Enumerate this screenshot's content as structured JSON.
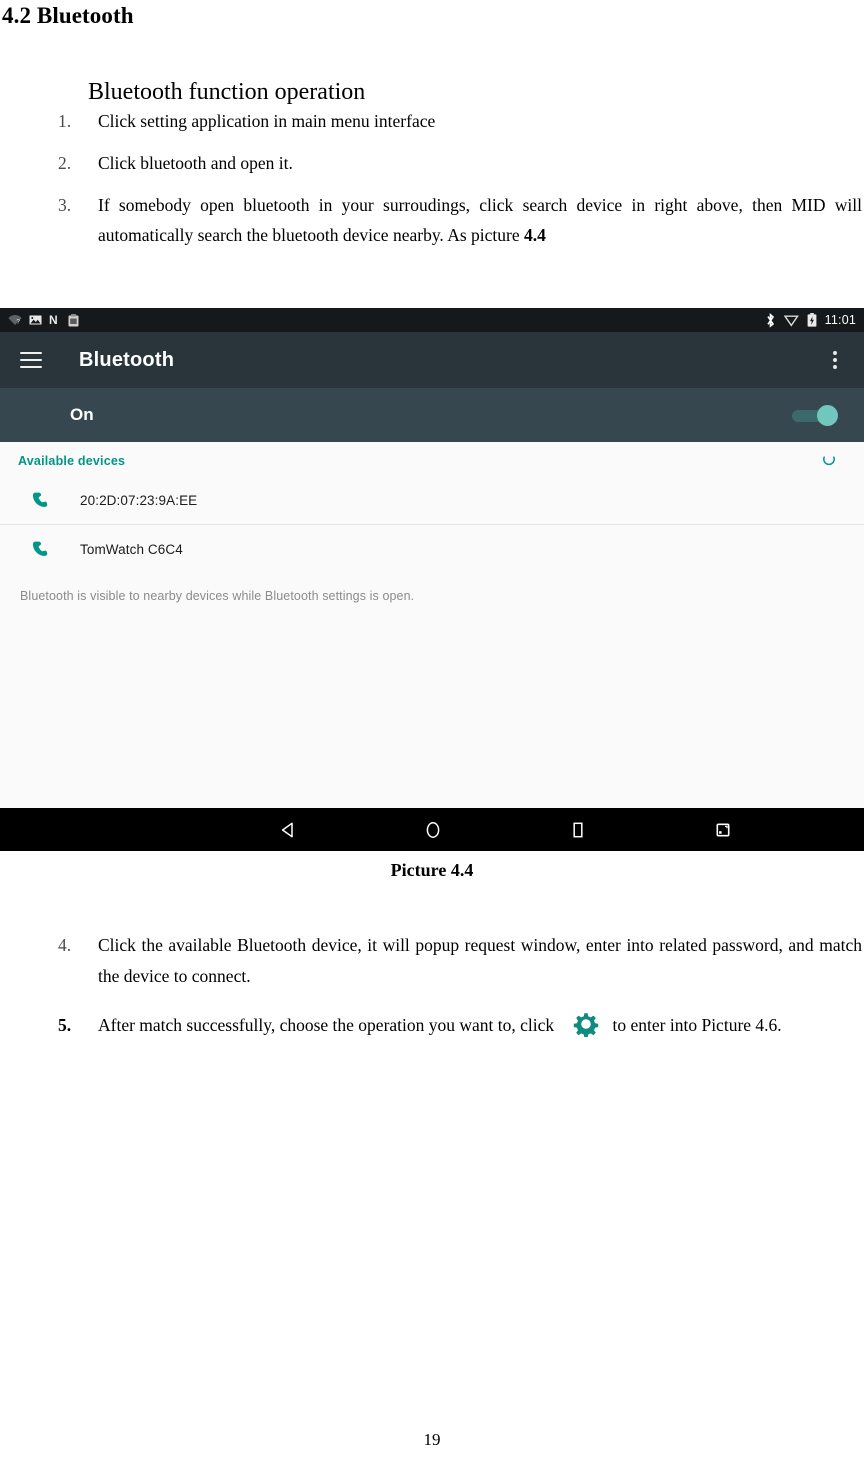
{
  "document": {
    "heading": "4.2 Bluetooth",
    "subheading": "Bluetooth function operation",
    "steps_top": [
      {
        "num": "1.",
        "text": "Click setting application in main menu interface",
        "bold_num": false
      },
      {
        "num": "2.",
        "text": "Click bluetooth and open it.",
        "bold_num": false
      },
      {
        "num": "3.",
        "text": "If somebody open bluetooth in your surroudings, click search device in right above, then MID will automatically search the bluetooth device nearby. As picture ",
        "bold_tail": "4.4",
        "bold_num": false
      }
    ],
    "caption": "Picture 4.4",
    "steps_bottom": [
      {
        "num": "4.",
        "text": "Click the available Bluetooth device, it will popup request window, enter into related password, and match the device to connect.",
        "bold_num": false
      },
      {
        "num": "5.",
        "text_before": "After match successfully, choose the operation you want to, click ",
        "text_after": "to enter into Picture 4.6.",
        "bold_num": true
      }
    ],
    "page_number": "19"
  },
  "screenshot": {
    "statusbar": {
      "left_icons": [
        "wifi-question-icon",
        "photo-icon",
        "android-n-icon",
        "clipboard-icon"
      ],
      "right_icons": [
        "bluetooth-icon",
        "signal-triangle-icon",
        "battery-charging-icon"
      ],
      "time": "11:01"
    },
    "toolbar": {
      "menu_icon": "hamburger-icon",
      "title": "Bluetooth",
      "overflow_icon": "overflow-menu-icon"
    },
    "switch_bar": {
      "label": "On",
      "switch_state": "on"
    },
    "section": {
      "title": "Available devices",
      "refresh_icon": "refresh-icon"
    },
    "devices": [
      {
        "icon": "phone-icon",
        "name": "20:2D:07:23:9A:EE"
      },
      {
        "icon": "phone-icon",
        "name": "TomWatch C6C4"
      }
    ],
    "hint": "Bluetooth is visible to nearby devices while Bluetooth settings is open.",
    "navbar": [
      {
        "name": "back-button",
        "icon": "back-triangle-icon"
      },
      {
        "name": "home-button",
        "icon": "home-circle-icon"
      },
      {
        "name": "recents-button",
        "icon": "recents-square-icon"
      },
      {
        "name": "screenshot-button",
        "icon": "screenshot-icon"
      }
    ]
  },
  "colors": {
    "status_bar": "#16191b",
    "toolbar": "#29353a",
    "switch_bar": "#37474f",
    "accent_teal": "#009688",
    "switch_thumb": "#71c6be",
    "list_bg": "#fafafa",
    "nav_bar": "#000000"
  }
}
